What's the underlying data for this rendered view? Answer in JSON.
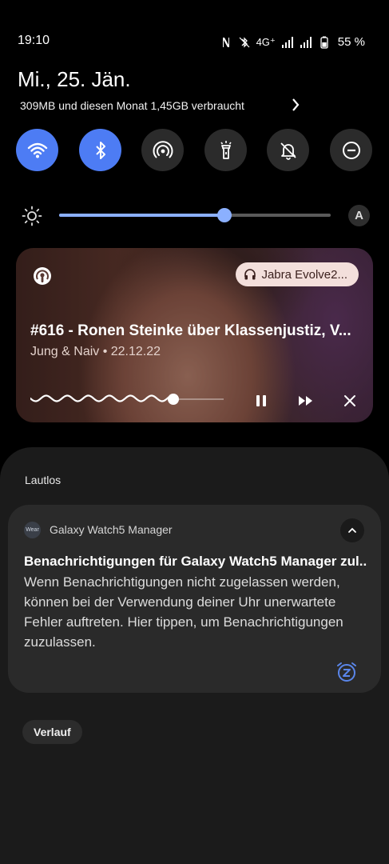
{
  "status": {
    "time": "19:10",
    "network": "4G⁺",
    "battery": "55 %",
    "icons": [
      "nfc-icon",
      "bluetooth-muted-icon",
      "signal-icon",
      "signal-icon",
      "battery-icon"
    ]
  },
  "header": {
    "date": "Mi., 25. Jän.",
    "data_usage": "309MB und diesen Monat 1,45GB verbraucht"
  },
  "quick_toggles": [
    {
      "name": "wifi",
      "icon": "wifi-icon",
      "active": true
    },
    {
      "name": "bluetooth",
      "icon": "bluetooth-icon",
      "active": true
    },
    {
      "name": "hotspot",
      "icon": "hotspot-icon",
      "active": false
    },
    {
      "name": "flashlight",
      "icon": "flashlight-icon",
      "active": false
    },
    {
      "name": "mute",
      "icon": "bell-off-icon",
      "active": false
    },
    {
      "name": "do-not-disturb",
      "icon": "minus-circle-icon",
      "active": false
    }
  ],
  "brightness": {
    "level": 0.61,
    "auto_label": "A"
  },
  "media": {
    "output_device": "Jabra Evolve2...",
    "title": "#616 - Ronen Steinke über Klassenjustiz, V...",
    "subtitle": "Jung & Naiv • 22.12.22",
    "progress": 0.74
  },
  "notifications": {
    "section_label": "Lautlos",
    "items": [
      {
        "app_badge": "Wear",
        "app_name": "Galaxy Watch5 Manager",
        "title": "Benachrichtigungen für Galaxy Watch5 Manager zul..",
        "body": "Wenn Benachrichtigungen nicht zugelassen werden, können bei der Verwendung deiner Uhr unerwartete Fehler auftreten. Hier tippen, um Benachrichtigungen zuzulassen."
      }
    ],
    "history_label": "Verlauf"
  },
  "colors": {
    "accent": "#4d7cf4",
    "slider": "#8bb0ff",
    "snooze": "#5a86ea"
  }
}
